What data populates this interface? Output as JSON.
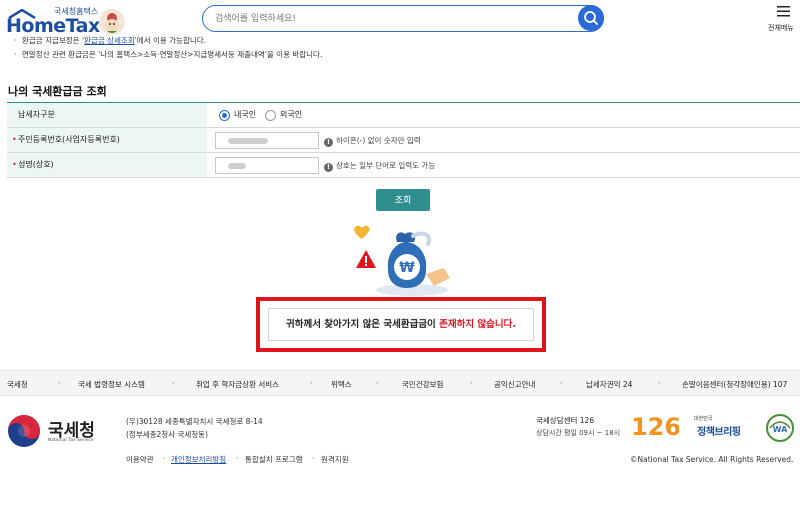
{
  "header": {
    "logo_sub": "국세청홈택스",
    "logo_main": "HomeTax",
    "search_placeholder": "검색어를 입력하세요!",
    "menu_label": "전체메뉴"
  },
  "notices": [
    {
      "prefix": "환급금 지급보정은 '",
      "link": "환급금 상세조회",
      "suffix": "'에서 이용 가능합니다."
    },
    {
      "text": "연말정산 관련 환급금은 '나의 홈택스>소득·연말정산>지급명세서등 제출내역'을 이용 바랍니다."
    }
  ],
  "section": {
    "title": "나의 국세환급금 조회"
  },
  "form": {
    "taxpayer_type_label": "납세자구분",
    "domestic_label": "내국인",
    "foreign_label": "외국인",
    "selected": "내국인",
    "resident_no_label": "주민등록번호(사업자등록번호)",
    "resident_no_hint": "하이픈(-) 없이 숫자만 입력",
    "name_label": "성명(상호)",
    "name_hint": "상호는 일부 단어로 입력도 가능",
    "required_mark": "•",
    "hint_icon": "!"
  },
  "query_button": "조회",
  "result": {
    "prefix": "귀하께서 찾아가지 않은 국세환급금이 ",
    "emphasis": "존재하지 않습니다."
  },
  "links_bar": [
    "국세청",
    "국세 법령정보 시스템",
    "취업 후 학자금상환 서비스",
    "위택스",
    "국민건강보험",
    "공익신고안내",
    "납세자권익 24",
    "손말이음센터(청각장애인용) 107"
  ],
  "footer": {
    "nts_name": "국세청",
    "nts_sub": "National Tax Service",
    "address_1": "(우)30128 세종특별자치시 국세청로 8-14",
    "address_2": "(정부세종2청사 국세청동)",
    "links": [
      "이용약관",
      "개인정보처리방침",
      "통합설치 프로그램",
      "원격지원"
    ],
    "center_title": "국세상담센터 126",
    "center_hours": "상담시간 평일 09시 ~ 18시",
    "logo_126": "126",
    "policy_small": "대한민국",
    "policy_big": "정책브리핑",
    "wa_label": "WA",
    "copyright": "©National Tax Service. All Rights Reserved."
  },
  "colors": {
    "primary_blue": "#2b6bd8",
    "teal": "#2f8f8f",
    "alert_red": "#e0141b"
  }
}
